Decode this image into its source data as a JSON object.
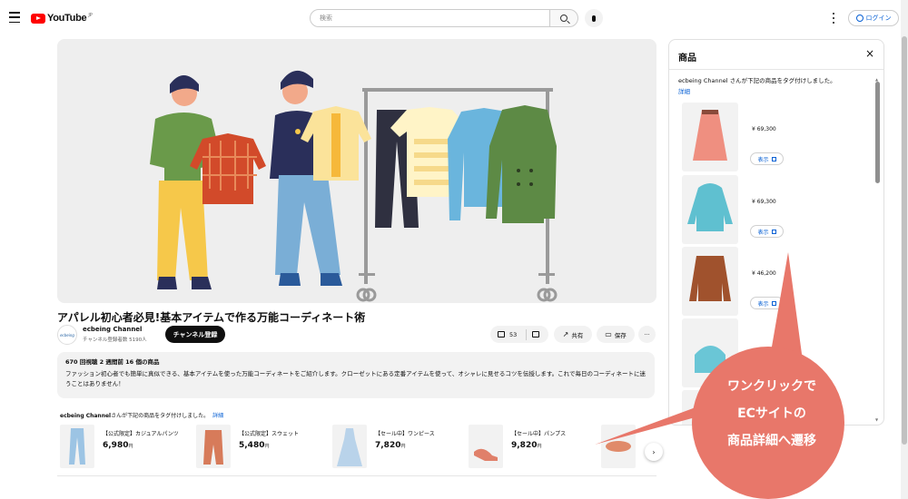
{
  "header": {
    "logo_text": "YouTube",
    "logo_suffix": "JP",
    "search_placeholder": "検索",
    "login_label": "ログイン"
  },
  "video": {
    "title": "アパレル初心者必見!基本アイテムで作る万能コーディネート術",
    "channel_avatar_text": "ecbeing",
    "channel_name": "ecbeing Channel",
    "channel_subs": "チャンネル登録者数 5190人",
    "subscribe_label": "チャンネル登録",
    "like_count": "53",
    "share_label": "共有",
    "save_label": "保存",
    "more_label": "···"
  },
  "description": {
    "stats": "670 回視聴  2 週間前  16 個の商品",
    "body": "ファッション初心者でも簡単に真似できる、基本アイテムを使った万能コーディネートをご紹介します。クローゼットにある定番アイテムを使って、オシャレに見せるコツを伝授します。これで毎日のコーディネートに迷うことはありません！"
  },
  "product_tag": {
    "channel": "ecbeing Channel",
    "text": "さんが下記の商品をタグ付けしました。",
    "detail_link": "詳細"
  },
  "products": [
    {
      "name": "【公式限定】カジュアルパンツ",
      "price": "6,980",
      "currency": "円"
    },
    {
      "name": "【公式限定】スウェット",
      "price": "5,480",
      "currency": "円"
    },
    {
      "name": "【セール中】ワンピース",
      "price": "7,820",
      "currency": "円"
    },
    {
      "name": "【セール中】パンプス",
      "price": "9,820",
      "currency": "円"
    }
  ],
  "panel": {
    "title": "商品",
    "close_icon": "×",
    "text": "ecbeing Channel さんが下記の商品をタグ付けしました。",
    "detail_link": "詳細",
    "items": [
      {
        "price": "¥ 69,300",
        "view_label": "表示"
      },
      {
        "price": "¥ 69,300",
        "view_label": "表示"
      },
      {
        "price": "¥ 46,200",
        "view_label": "表示"
      }
    ]
  },
  "callout": {
    "line1": "ワンクリックで",
    "line2": "ECサイトの",
    "line3": "商品詳細へ遷移",
    "color": "#e8776a"
  },
  "next_icon": "›"
}
